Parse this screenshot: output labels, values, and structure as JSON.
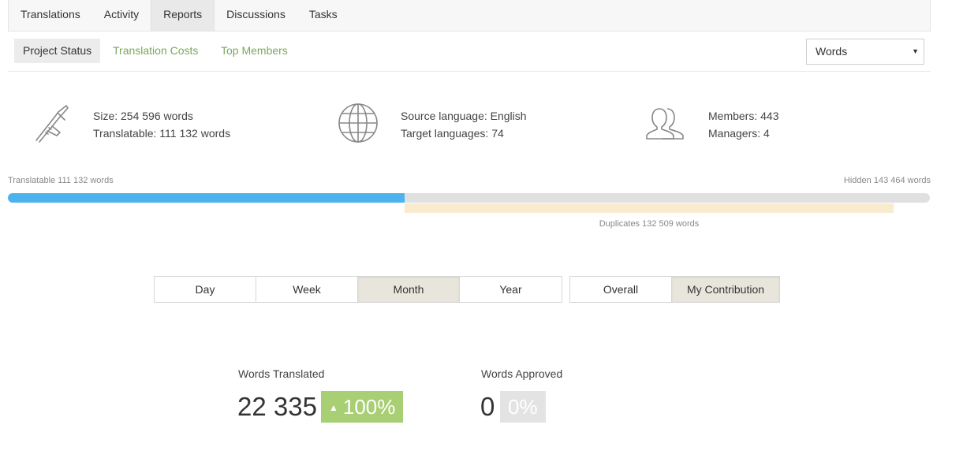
{
  "top_tabs": [
    {
      "label": "Translations",
      "active": false
    },
    {
      "label": "Activity",
      "active": false
    },
    {
      "label": "Reports",
      "active": true
    },
    {
      "label": "Discussions",
      "active": false
    },
    {
      "label": "Tasks",
      "active": false
    }
  ],
  "sub_nav": {
    "items": [
      {
        "label": "Project Status",
        "active": true
      },
      {
        "label": "Translation Costs",
        "active": false
      },
      {
        "label": "Top Members",
        "active": false
      }
    ],
    "unit_select": {
      "value": "Words"
    }
  },
  "stats": {
    "size": {
      "icon": "caliper-icon",
      "line1": "Size: 254 596 words",
      "line2": "Translatable: 111 132 words"
    },
    "languages": {
      "icon": "globe-icon",
      "line1": "Source language: English",
      "line2": "Target languages: 74"
    },
    "members": {
      "icon": "members-icon",
      "line1": "Members: 443",
      "line2": "Managers: 4"
    }
  },
  "progress": {
    "translatable_label": "Translatable 111 132 words",
    "hidden_label": "Hidden 143 464 words",
    "duplicates_label": "Duplicates 132 509 words",
    "translatable_fraction": 0.43,
    "duplicates_start_fraction": 0.43,
    "duplicates_end_fraction": 0.961
  },
  "period": {
    "options": [
      {
        "label": "Day",
        "active": false
      },
      {
        "label": "Week",
        "active": false
      },
      {
        "label": "Month",
        "active": true
      },
      {
        "label": "Year",
        "active": false
      }
    ]
  },
  "scope": {
    "options": [
      {
        "label": "Overall",
        "active": false
      },
      {
        "label": "My Contribution",
        "active": true
      }
    ]
  },
  "metrics": {
    "translated": {
      "label": "Words Translated",
      "value": "22 335",
      "badge": "100%",
      "badge_arrow": "▲"
    },
    "approved": {
      "label": "Words Approved",
      "value": "0",
      "badge": "0%"
    }
  },
  "colors": {
    "accent_link": "#7aa85a",
    "progress_blue": "#4db3ee",
    "duplicates": "#f9ebcd",
    "badge_green": "#a8cf74",
    "badge_grey": "#e3e3e3"
  }
}
